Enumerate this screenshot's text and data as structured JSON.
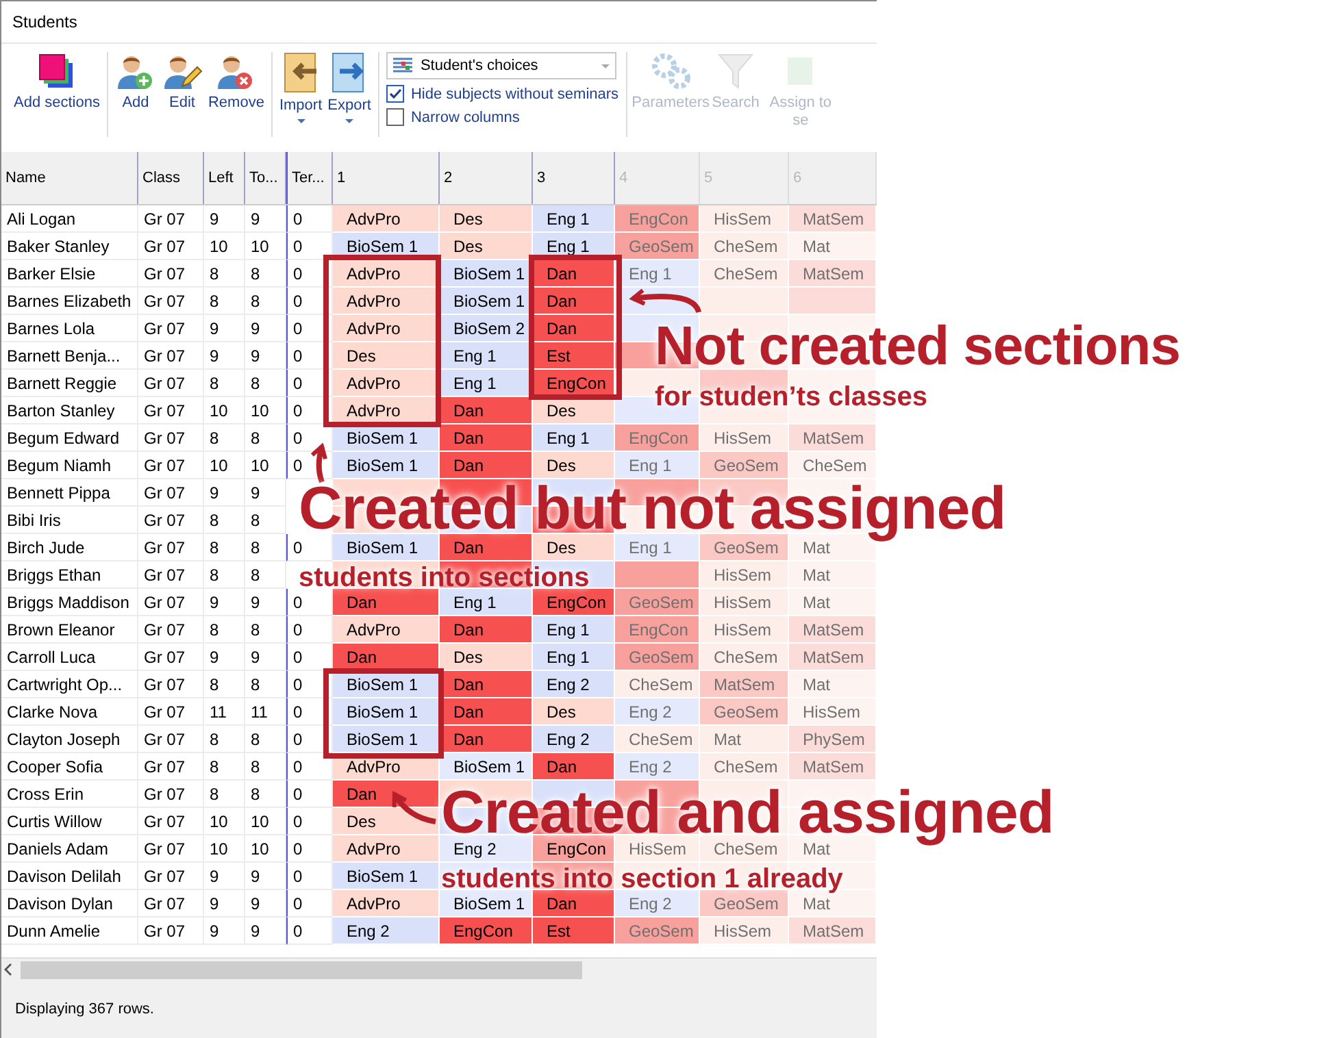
{
  "window": {
    "title": "Students"
  },
  "toolbar": {
    "groups": [
      {
        "buttons": [
          {
            "label": "Add sections",
            "kind": "sections",
            "dropdown": false
          }
        ]
      },
      {
        "buttons": [
          {
            "label": "Add",
            "kind": "person-add",
            "dropdown": false
          },
          {
            "label": "Edit",
            "kind": "person-edit",
            "dropdown": false
          },
          {
            "label": "Remove",
            "kind": "person-remove",
            "dropdown": false
          }
        ]
      },
      {
        "buttons": [
          {
            "label": "Import",
            "kind": "import",
            "dropdown": true
          },
          {
            "label": "Export",
            "kind": "export",
            "dropdown": true
          }
        ]
      }
    ],
    "view_select": {
      "value": "Student's choices"
    },
    "options": [
      {
        "label": "Hide subjects without seminars",
        "checked": true
      },
      {
        "label": "Narrow columns",
        "checked": false
      }
    ],
    "tools": [
      {
        "label": "Parameters",
        "kind": "gears",
        "disabled": true
      },
      {
        "label": "Search",
        "kind": "funnel",
        "disabled": true
      },
      {
        "label": "Assign to se",
        "kind": "assign",
        "disabled": true
      }
    ]
  },
  "table": {
    "columns": [
      {
        "label": "Name",
        "disabled": false
      },
      {
        "label": "Class",
        "disabled": false
      },
      {
        "label": "Left",
        "disabled": false
      },
      {
        "label": "To...",
        "disabled": false
      },
      {
        "label": "Ter...",
        "disabled": false
      },
      {
        "label": "1",
        "disabled": false
      },
      {
        "label": "2",
        "disabled": false
      },
      {
        "label": "3",
        "disabled": false
      },
      {
        "label": "4",
        "disabled": true
      },
      {
        "label": "5",
        "disabled": true
      },
      {
        "label": "6",
        "disabled": true
      }
    ],
    "rows": [
      {
        "cells": [
          "Ali Logan",
          "Gr 07",
          "9",
          "9",
          "0"
        ],
        "subjects": [
          {
            "text": "AdvPro",
            "color": "#fdd9cf"
          },
          {
            "text": "Des",
            "color": "#fdd9cf"
          },
          {
            "text": "Eng 1",
            "color": "#d8e0fa"
          },
          {
            "text": "EngCon",
            "color": "#f8a09c"
          },
          {
            "text": "HisSem",
            "color": "#fdeee9"
          },
          {
            "text": "MatSem",
            "color": "#fcdcd8"
          }
        ]
      },
      {
        "cells": [
          "Baker Stanley",
          "Gr 07",
          "10",
          "10",
          "0"
        ],
        "subjects": [
          {
            "text": "BioSem 1",
            "color": "#d8e0fa"
          },
          {
            "text": "Des",
            "color": "#fdd9cf"
          },
          {
            "text": "Eng 1",
            "color": "#d8e0fa"
          },
          {
            "text": "GeoSem",
            "color": "#f8a09c"
          },
          {
            "text": "CheSem",
            "color": "#fdeee9"
          },
          {
            "text": "Mat",
            "color": "#fdf4f2"
          }
        ]
      },
      {
        "cells": [
          "Barker Elsie",
          "Gr 07",
          "8",
          "8",
          "0"
        ],
        "subjects": [
          {
            "text": "AdvPro",
            "color": "#fdd9cf"
          },
          {
            "text": "BioSem 1",
            "color": "#d8e0fa"
          },
          {
            "text": "Dan",
            "color": "#f75050"
          },
          {
            "text": "Eng 1",
            "color": "#e4e9fb"
          },
          {
            "text": "CheSem",
            "color": "#fdeee9"
          },
          {
            "text": "MatSem",
            "color": "#fcdcd8"
          }
        ]
      },
      {
        "cells": [
          "Barnes Elizabeth",
          "Gr 07",
          "8",
          "8",
          "0"
        ],
        "subjects": [
          {
            "text": "AdvPro",
            "color": "#fdd9cf"
          },
          {
            "text": "BioSem 1",
            "color": "#d8e0fa"
          },
          {
            "text": "Dan",
            "color": "#f75050"
          },
          {
            "color": "#e4e9fb"
          },
          {
            "color": "#fdeee9"
          },
          {
            "color": "#fcdcd8"
          }
        ]
      },
      {
        "cells": [
          "Barnes Lola",
          "Gr 07",
          "9",
          "9",
          "0"
        ],
        "subjects": [
          {
            "text": "AdvPro",
            "color": "#fdd9cf"
          },
          {
            "text": "BioSem 2",
            "color": "#d8e0fa"
          },
          {
            "text": "Dan",
            "color": "#f75050"
          },
          {
            "color": "#e4e9fb"
          },
          {
            "color": "#fdeee9"
          },
          {
            "color": "#fdf4f2"
          }
        ]
      },
      {
        "cells": [
          "Barnett Benja...",
          "Gr 07",
          "9",
          "9",
          "0"
        ],
        "subjects": [
          {
            "text": "Des",
            "color": "#fdd9cf"
          },
          {
            "text": "Eng 1",
            "color": "#d8e0fa"
          },
          {
            "text": "Est",
            "color": "#f75050"
          },
          {
            "color": "#f8a09c"
          },
          {
            "color": "#fdeee9"
          },
          {
            "color": "#fdf4f2"
          }
        ]
      },
      {
        "cells": [
          "Barnett Reggie",
          "Gr 07",
          "8",
          "8",
          "0"
        ],
        "subjects": [
          {
            "text": "AdvPro",
            "color": "#fdd9cf"
          },
          {
            "text": "Eng 1",
            "color": "#d8e0fa"
          },
          {
            "text": "EngCon",
            "color": "#f75050"
          },
          {
            "color": "#fdeee9"
          },
          {
            "color": "#fbc8c4"
          },
          {
            "color": "#fdf4f2"
          }
        ]
      },
      {
        "cells": [
          "Barton Stanley",
          "Gr 07",
          "10",
          "10",
          "0"
        ],
        "subjects": [
          {
            "text": "AdvPro",
            "color": "#fdd9cf"
          },
          {
            "text": "Dan",
            "color": "#f75050"
          },
          {
            "text": "Des",
            "color": "#fdd9cf"
          },
          {
            "color": "#e4e9fb"
          },
          {
            "color": "#fdeee9"
          },
          {
            "color": "#fdf4f2"
          }
        ]
      },
      {
        "cells": [
          "Begum Edward",
          "Gr 07",
          "8",
          "8",
          "0"
        ],
        "subjects": [
          {
            "text": "BioSem 1",
            "color": "#d8e0fa"
          },
          {
            "text": "Dan",
            "color": "#f75050"
          },
          {
            "text": "Eng 1",
            "color": "#d8e0fa"
          },
          {
            "text": "EngCon",
            "color": "#f8a09c"
          },
          {
            "text": "HisSem",
            "color": "#fdeee9"
          },
          {
            "text": "MatSem",
            "color": "#fcdcd8"
          }
        ]
      },
      {
        "cells": [
          "Begum Niamh",
          "Gr 07",
          "10",
          "10",
          "0"
        ],
        "subjects": [
          {
            "text": "BioSem 1",
            "color": "#d8e0fa"
          },
          {
            "text": "Dan",
            "color": "#f75050"
          },
          {
            "text": "Des",
            "color": "#fdd9cf"
          },
          {
            "text": "Eng 1",
            "color": "#e4e9fb"
          },
          {
            "text": "GeoSem",
            "color": "#fbc8c4"
          },
          {
            "text": "CheSem",
            "color": "#fdf4f2"
          }
        ]
      },
      {
        "cells": [
          "Bennett Pippa",
          "Gr 07",
          "9",
          "9",
          null
        ],
        "subjects": [
          {
            "color": "#fdd9cf"
          },
          {
            "color": "#f75050"
          },
          {
            "color": "#d8e0fa"
          },
          {
            "color": "#f8a09c"
          },
          {
            "color": "#fbc8c4"
          },
          {
            "color": "#fdf4f2"
          }
        ]
      },
      {
        "cells": [
          "Bibi Iris",
          "Gr 07",
          "8",
          "8",
          null
        ],
        "subjects": [
          {
            "color": "#fdd9cf"
          },
          {
            "color": "#d8e0fa"
          },
          {
            "color": "#f75050"
          },
          {
            "color": "#fdeee9"
          },
          {
            "color": "#fdeee9"
          },
          {
            "color": "#fdf4f2"
          }
        ]
      },
      {
        "cells": [
          "Birch Jude",
          "Gr 07",
          "8",
          "8",
          "0"
        ],
        "subjects": [
          {
            "text": "BioSem 1",
            "color": "#d8e0fa"
          },
          {
            "text": "Dan",
            "color": "#f75050"
          },
          {
            "text": "Des",
            "color": "#fdd9cf"
          },
          {
            "text": "Eng 1",
            "color": "#e4e9fb"
          },
          {
            "text": "GeoSem",
            "color": "#fbc8c4"
          },
          {
            "text": "Mat",
            "color": "#fdf4f2"
          }
        ]
      },
      {
        "cells": [
          "Briggs Ethan",
          "Gr 07",
          "8",
          "8",
          null
        ],
        "subjects": [
          {
            "color": "#fdd9cf"
          },
          {
            "color": "#f75050"
          },
          {
            "color": "#d8e0fa"
          },
          {
            "color": "#f8a09c"
          },
          {
            "text": "HisSem",
            "color": "#fdeee9"
          },
          {
            "text": "Mat",
            "color": "#fdf4f2"
          }
        ]
      },
      {
        "cells": [
          "Briggs Maddison",
          "Gr 07",
          "9",
          "9",
          "0"
        ],
        "subjects": [
          {
            "text": "Dan",
            "color": "#f75050"
          },
          {
            "text": "Eng 1",
            "color": "#d8e0fa"
          },
          {
            "text": "EngCon",
            "color": "#f75050"
          },
          {
            "text": "GeoSem",
            "color": "#f8a09c"
          },
          {
            "text": "HisSem",
            "color": "#fdeee9"
          },
          {
            "text": "Mat",
            "color": "#fdf4f2"
          }
        ]
      },
      {
        "cells": [
          "Brown Eleanor",
          "Gr 07",
          "8",
          "8",
          "0"
        ],
        "subjects": [
          {
            "text": "AdvPro",
            "color": "#fdd9cf"
          },
          {
            "text": "Dan",
            "color": "#f75050"
          },
          {
            "text": "Eng 1",
            "color": "#d8e0fa"
          },
          {
            "text": "EngCon",
            "color": "#f8a09c"
          },
          {
            "text": "HisSem",
            "color": "#fdeee9"
          },
          {
            "text": "MatSem",
            "color": "#fcdcd8"
          }
        ]
      },
      {
        "cells": [
          "Carroll Luca",
          "Gr 07",
          "9",
          "9",
          "0"
        ],
        "subjects": [
          {
            "text": "Dan",
            "color": "#f75050"
          },
          {
            "text": "Des",
            "color": "#fdd9cf"
          },
          {
            "text": "Eng 1",
            "color": "#d8e0fa"
          },
          {
            "text": "GeoSem",
            "color": "#f8a09c"
          },
          {
            "text": "CheSem",
            "color": "#fdeee9"
          },
          {
            "text": "MatSem",
            "color": "#fcdcd8"
          }
        ]
      },
      {
        "cells": [
          "Cartwright Op...",
          "Gr 07",
          "8",
          "8",
          "0"
        ],
        "subjects": [
          {
            "text": "BioSem 1",
            "color": "#d8e0fa"
          },
          {
            "text": "Dan",
            "color": "#f75050"
          },
          {
            "text": "Eng 2",
            "color": "#d8e0fa"
          },
          {
            "text": "CheSem",
            "color": "#fdeee9"
          },
          {
            "text": "MatSem",
            "color": "#fbc8c4"
          },
          {
            "text": "Mat",
            "color": "#fdf4f2"
          }
        ]
      },
      {
        "cells": [
          "Clarke Nova",
          "Gr 07",
          "11",
          "11",
          "0"
        ],
        "subjects": [
          {
            "text": "BioSem 1",
            "color": "#d8e0fa"
          },
          {
            "text": "Dan",
            "color": "#f75050"
          },
          {
            "text": "Des",
            "color": "#fdd9cf"
          },
          {
            "text": "Eng 2",
            "color": "#e4e9fb"
          },
          {
            "text": "GeoSem",
            "color": "#fbc8c4"
          },
          {
            "text": "HisSem",
            "color": "#fdf4f2"
          }
        ]
      },
      {
        "cells": [
          "Clayton Joseph",
          "Gr 07",
          "8",
          "8",
          "0"
        ],
        "subjects": [
          {
            "text": "BioSem 1",
            "color": "#d8e0fa"
          },
          {
            "text": "Dan",
            "color": "#f75050"
          },
          {
            "text": "Eng 2",
            "color": "#d8e0fa"
          },
          {
            "text": "CheSem",
            "color": "#fdeee9"
          },
          {
            "text": "Mat",
            "color": "#fdeee9"
          },
          {
            "text": "PhySem",
            "color": "#fcdcd8"
          }
        ]
      },
      {
        "cells": [
          "Cooper Sofia",
          "Gr 07",
          "8",
          "8",
          "0"
        ],
        "subjects": [
          {
            "text": "AdvPro",
            "color": "#fdd9cf"
          },
          {
            "text": "BioSem 1",
            "color": "#e4e9fb"
          },
          {
            "text": "Dan",
            "color": "#f75050"
          },
          {
            "text": "Eng 2",
            "color": "#e4e9fb"
          },
          {
            "text": "CheSem",
            "color": "#fdeee9"
          },
          {
            "text": "MatSem",
            "color": "#fcdcd8"
          }
        ]
      },
      {
        "cells": [
          "Cross Erin",
          "Gr 07",
          "8",
          "8",
          "0"
        ],
        "subjects": [
          {
            "text": "Dan",
            "color": "#f75050"
          },
          {
            "color": "#fdd9cf"
          },
          {
            "color": "#d8e0fa"
          },
          {
            "color": "#f8a09c"
          },
          {
            "color": "#fdeee9"
          },
          {
            "color": "#fdf4f2"
          }
        ]
      },
      {
        "cells": [
          "Curtis Willow",
          "Gr 07",
          "10",
          "10",
          "0"
        ],
        "subjects": [
          {
            "text": "Des",
            "color": "#fdd9cf"
          },
          {
            "color": "#d8e0fa"
          },
          {
            "color": "#f75050"
          },
          {
            "color": "#f8a09c"
          },
          {
            "color": "#fdeee9"
          },
          {
            "color": "#fdf4f2"
          }
        ]
      },
      {
        "cells": [
          "Daniels Adam",
          "Gr 07",
          "10",
          "10",
          "0"
        ],
        "subjects": [
          {
            "text": "AdvPro",
            "color": "#fdd9cf"
          },
          {
            "text": "Eng 2",
            "color": "#e4e9fb"
          },
          {
            "text": "EngCon",
            "color": "#f8a09c"
          },
          {
            "text": "HisSem",
            "color": "#fdeee9"
          },
          {
            "text": "CheSem",
            "color": "#fdeee9"
          },
          {
            "text": "Mat",
            "color": "#fdf4f2"
          }
        ]
      },
      {
        "cells": [
          "Davison Delilah",
          "Gr 07",
          "9",
          "9",
          "0"
        ],
        "subjects": [
          {
            "text": "BioSem 1",
            "color": "#d8e0fa"
          },
          {
            "color": "#e4e9fb"
          },
          {
            "color": "#f8a09c"
          },
          {
            "color": "#fdeee9"
          },
          {
            "color": "#fdeee9"
          },
          {
            "color": "#fdf4f2"
          }
        ]
      },
      {
        "cells": [
          "Davison Dylan",
          "Gr 07",
          "9",
          "9",
          "0"
        ],
        "subjects": [
          {
            "text": "AdvPro",
            "color": "#fdd9cf"
          },
          {
            "text": "BioSem 1",
            "color": "#e4e9fb"
          },
          {
            "text": "Dan",
            "color": "#f75050"
          },
          {
            "text": "Eng 2",
            "color": "#e4e9fb"
          },
          {
            "text": "GeoSem",
            "color": "#fbc8c4"
          },
          {
            "text": "Mat",
            "color": "#fdf4f2"
          }
        ]
      },
      {
        "cells": [
          "Dunn Amelie",
          "Gr 07",
          "9",
          "9",
          "0"
        ],
        "subjects": [
          {
            "text": "Eng 2",
            "color": "#d8e0fa"
          },
          {
            "text": "EngCon",
            "color": "#f75050"
          },
          {
            "text": "Est",
            "color": "#f75050"
          },
          {
            "text": "GeoSem",
            "color": "#f8a09c"
          },
          {
            "text": "HisSem",
            "color": "#fdeee9"
          },
          {
            "text": "MatSem",
            "color": "#fcdcd8"
          }
        ]
      }
    ]
  },
  "status_bar": {
    "text": "Displaying 367 rows."
  },
  "annotations": [
    {
      "title": "Not created sections",
      "subtitle": "for studen’ts classes"
    },
    {
      "title": "Created but not assigned",
      "subtitle": "students into sections"
    },
    {
      "title": "Created and assigned",
      "subtitle": "students into section 1 already"
    }
  ]
}
